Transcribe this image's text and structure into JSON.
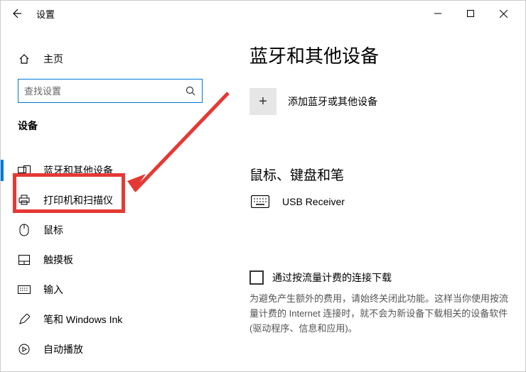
{
  "titlebar": {
    "title": "设置"
  },
  "sidebar": {
    "home": "主页",
    "search_placeholder": "查找设置",
    "section": "设备",
    "items": [
      {
        "label": "蓝牙和其他设备"
      },
      {
        "label": "打印机和扫描仪"
      },
      {
        "label": "鼠标"
      },
      {
        "label": "触摸板"
      },
      {
        "label": "输入"
      },
      {
        "label": "笔和 Windows Ink"
      },
      {
        "label": "自动播放"
      }
    ]
  },
  "content": {
    "heading": "蓝牙和其他设备",
    "add_label": "添加蓝牙或其他设备",
    "section2": "鼠标、键盘和笔",
    "device1": "USB Receiver",
    "checkbox_label": "通过按流量计费的连接下载",
    "desc": "为避免产生额外的费用，请始终关闭此功能。这样当你使用按流量计费的 Internet 连接时，就不会为新设备下载相关的设备软件(驱动程序、信息和应用)。"
  }
}
